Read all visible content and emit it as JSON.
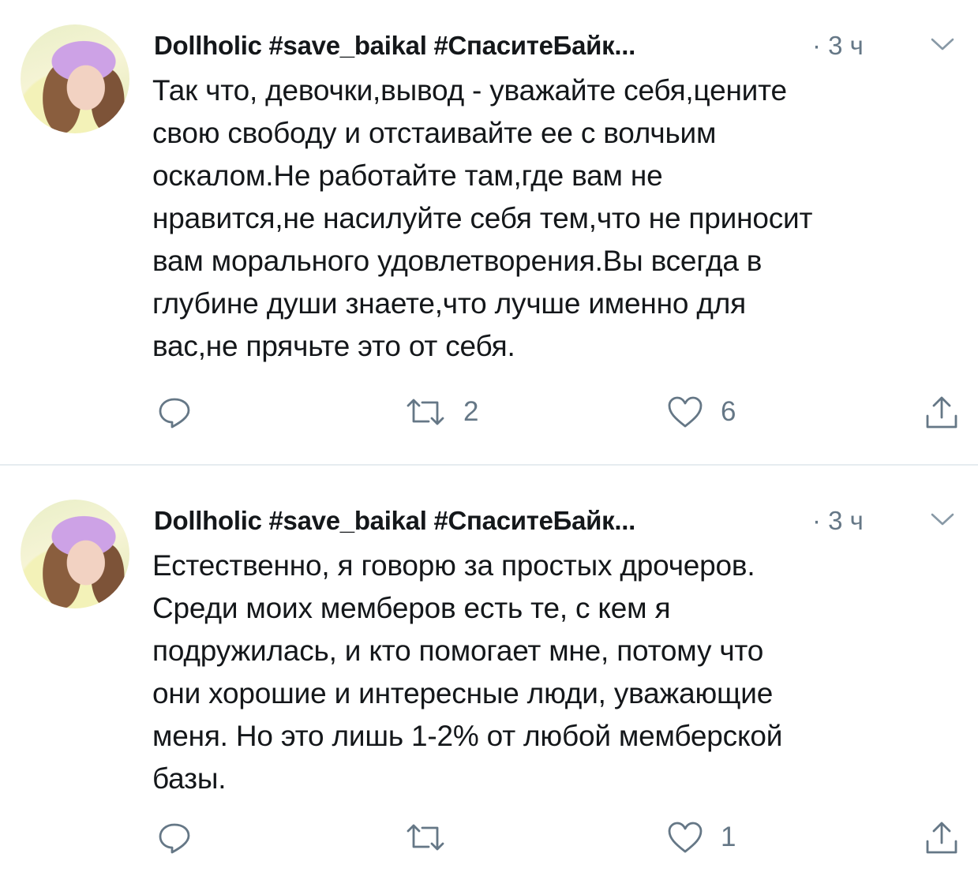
{
  "tweets": [
    {
      "author": "Dollholic #save_baikal #СпаситеБайк...",
      "time": "· 3 ч",
      "text_lines": [
        "Так что, девочки,вывод - уважайте себя,цените",
        "свою свободу и отстаивайте ее с волчьим",
        "оскалом.Не работайте там,где вам не",
        "нравится,не насилуйте себя тем,что не приносит",
        "вам морального удовлетворения.Вы всегда в",
        "глубине души знаете,что лучше именно для",
        "вас,не прячьте это от себя."
      ],
      "retweets": "2",
      "likes": "6"
    },
    {
      "author": "Dollholic #save_baikal #СпаситеБайк...",
      "time": "· 3 ч",
      "text_lines": [
        "Естественно, я говорю за простых дрочеров.",
        "Среди моих мемберов есть те, с кем я",
        "подружилась, и кто помогает мне, потому что",
        "они хорошие и интересные люди, уважающие",
        "меня. Но это лишь 1-2% от любой мемберской",
        "базы."
      ],
      "retweets": "",
      "likes": "1"
    }
  ],
  "icons": {
    "reply": "reply-icon",
    "retweet": "retweet-icon",
    "like": "heart-icon",
    "share": "share-icon",
    "menu": "chevron-down-icon"
  },
  "colors": {
    "text": "#14171a",
    "secondary": "#657786",
    "divider": "#e6ecf0"
  }
}
